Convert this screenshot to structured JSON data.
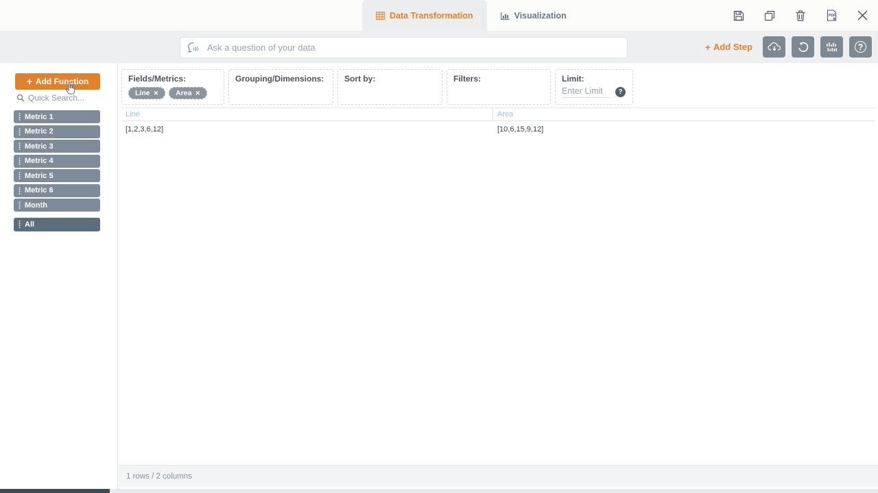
{
  "tabs": {
    "data_transformation": "Data Transformation",
    "visualization": "Visualization"
  },
  "search": {
    "placeholder": "Ask a question of your data"
  },
  "toolbar": {
    "add_step_label": "Add Step"
  },
  "icons": {
    "plus": "+",
    "chip_close": "✕",
    "question": "?"
  },
  "sidebar": {
    "add_function_label": "Add Function",
    "quick_search_placeholder": "Quick Search...",
    "fields": [
      "Metric 1",
      "Metric 2",
      "Metric 3",
      "Metric 4",
      "Metric 5",
      "Metric 6",
      "Month"
    ],
    "all_label": "All"
  },
  "panels": {
    "fields_metrics": {
      "label": "Fields/Metrics:",
      "chips": [
        {
          "label": "Line"
        },
        {
          "label": "Area"
        }
      ]
    },
    "grouping": {
      "label": "Grouping/Dimensions:"
    },
    "sort": {
      "label": "Sort by:"
    },
    "filters": {
      "label": "Filters:"
    },
    "limit": {
      "label": "Limit:",
      "placeholder": "Enter Limit"
    }
  },
  "table": {
    "columns": [
      "Line",
      "Area"
    ],
    "rows": [
      [
        "[1,2,3,6,12]",
        "[10,6,15,9,12]"
      ]
    ]
  },
  "footer": {
    "status": "1 rows / 2 columns"
  },
  "colors": {
    "accent": "#e0812e",
    "slate_button": "#7d8893",
    "sidebar_chip": "#7e8b99",
    "all_chip": "#5c6d7c",
    "header_blue": "#a0bdd8"
  }
}
